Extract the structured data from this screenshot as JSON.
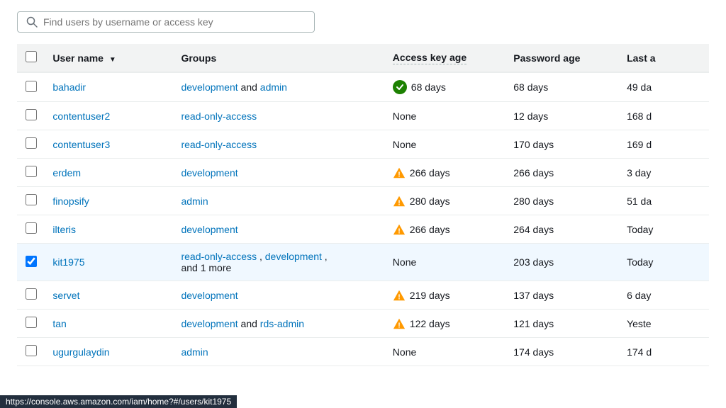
{
  "search": {
    "placeholder": "Find users by username or access key"
  },
  "table": {
    "columns": [
      {
        "id": "check",
        "label": ""
      },
      {
        "id": "username",
        "label": "User name",
        "sorted": true,
        "sortDir": "asc"
      },
      {
        "id": "groups",
        "label": "Groups"
      },
      {
        "id": "access_key_age",
        "label": "Access key age",
        "dashed": true
      },
      {
        "id": "password_age",
        "label": "Password age"
      },
      {
        "id": "last_activity",
        "label": "Last a",
        "truncated": true
      }
    ],
    "rows": [
      {
        "id": "bahadir",
        "username": "bahadir",
        "groups": [
          {
            "label": "development",
            "link": true
          },
          {
            "label": " and ",
            "link": false
          },
          {
            "label": "admin",
            "link": true
          }
        ],
        "groups_text": "development and admin",
        "access_key_age": "68 days",
        "access_key_status": "ok",
        "password_age": "68 days",
        "last_activity": "49 da",
        "selected": false
      },
      {
        "id": "contentuser2",
        "username": "contentuser2",
        "groups": [
          {
            "label": "read-only-access",
            "link": true
          }
        ],
        "groups_text": "read-only-access",
        "access_key_age": "None",
        "access_key_status": "none",
        "password_age": "12 days",
        "last_activity": "168 d",
        "selected": false
      },
      {
        "id": "contentuser3",
        "username": "contentuser3",
        "groups": [
          {
            "label": "read-only-access",
            "link": true
          }
        ],
        "groups_text": "read-only-access",
        "access_key_age": "None",
        "access_key_status": "none",
        "password_age": "170 days",
        "last_activity": "169 d",
        "selected": false
      },
      {
        "id": "erdem",
        "username": "erdem",
        "groups": [
          {
            "label": "development",
            "link": true
          }
        ],
        "groups_text": "development",
        "access_key_age": "266 days",
        "access_key_status": "warn",
        "password_age": "266 days",
        "last_activity": "3 day",
        "selected": false
      },
      {
        "id": "finopsify",
        "username": "finopsify",
        "groups": [
          {
            "label": "admin",
            "link": true
          }
        ],
        "groups_text": "admin",
        "access_key_age": "280 days",
        "access_key_status": "warn",
        "password_age": "280 days",
        "last_activity": "51 da",
        "selected": false
      },
      {
        "id": "ilteris",
        "username": "ilteris",
        "groups": [
          {
            "label": "development",
            "link": true
          }
        ],
        "groups_text": "development",
        "access_key_age": "266 days",
        "access_key_status": "warn",
        "password_age": "264 days",
        "last_activity": "Today",
        "selected": false
      },
      {
        "id": "kit1975",
        "username": "kit1975",
        "groups": [
          {
            "label": "read-only-access",
            "link": true
          },
          {
            "label": " , ",
            "link": false
          },
          {
            "label": "development",
            "link": true
          },
          {
            "label": " ,",
            "link": false
          }
        ],
        "groups_extra": "and 1 more",
        "groups_text": "read-only-access , development , and 1 more",
        "access_key_age": "None",
        "access_key_status": "none",
        "password_age": "203 days",
        "last_activity": "Today",
        "selected": true
      },
      {
        "id": "servet",
        "username": "servet",
        "groups": [
          {
            "label": "development",
            "link": true
          }
        ],
        "groups_text": "development",
        "access_key_age": "219 days",
        "access_key_status": "warn",
        "password_age": "137 days",
        "last_activity": "6 day",
        "selected": false
      },
      {
        "id": "tan",
        "username": "tan",
        "groups": [
          {
            "label": "development",
            "link": true
          },
          {
            "label": " and ",
            "link": false
          },
          {
            "label": "rds-admin",
            "link": true
          }
        ],
        "groups_text": "development and rds-admin",
        "access_key_age": "122 days",
        "access_key_status": "warn",
        "password_age": "121 days",
        "last_activity": "Yeste",
        "selected": false
      },
      {
        "id": "ugurgulaydin",
        "username": "ugurgulaydin",
        "groups": [
          {
            "label": "admin",
            "link": true
          }
        ],
        "groups_text": "admin",
        "access_key_age": "None",
        "access_key_status": "none",
        "password_age": "174 days",
        "last_activity": "174 d",
        "selected": false
      }
    ]
  },
  "statusbar": {
    "url": "https://console.aws.amazon.com/iam/home?#/users/kit1975"
  }
}
